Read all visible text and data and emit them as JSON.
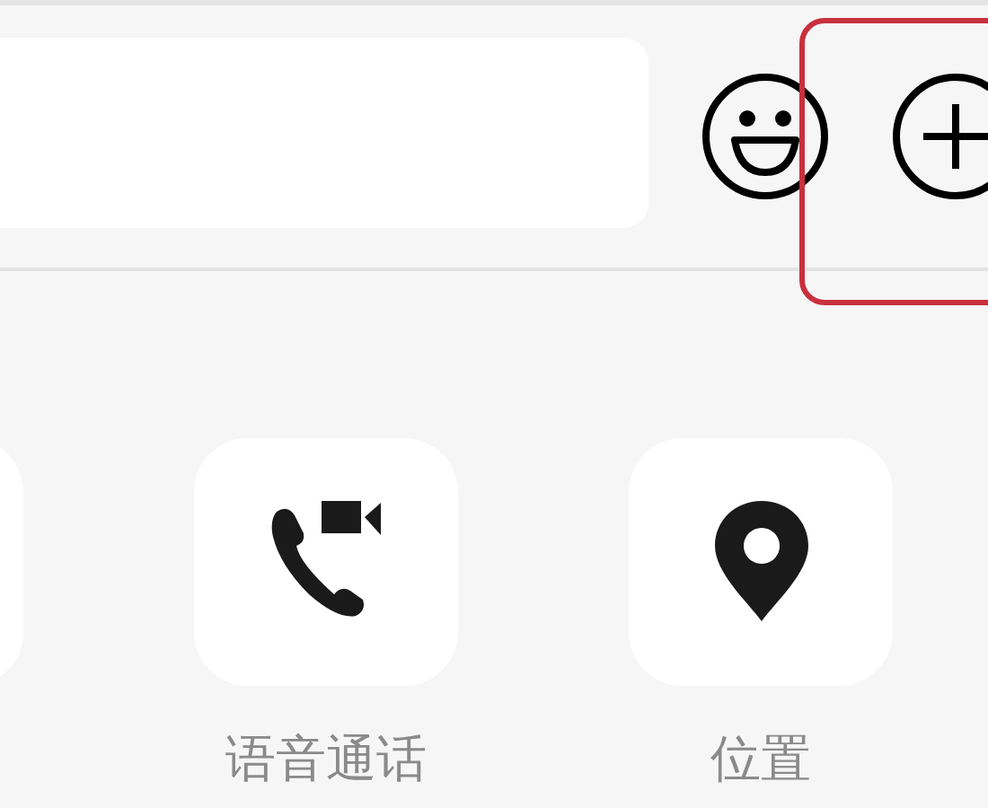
{
  "input_bar": {
    "field": {
      "kind": "text"
    },
    "buttons": [
      {
        "kind": "emoji"
      },
      {
        "kind": "plus"
      }
    ]
  },
  "actions": [
    {
      "kind": "blank"
    },
    {
      "kind": "call",
      "label": "语音通话"
    },
    {
      "kind": "location",
      "label": "位置"
    }
  ]
}
